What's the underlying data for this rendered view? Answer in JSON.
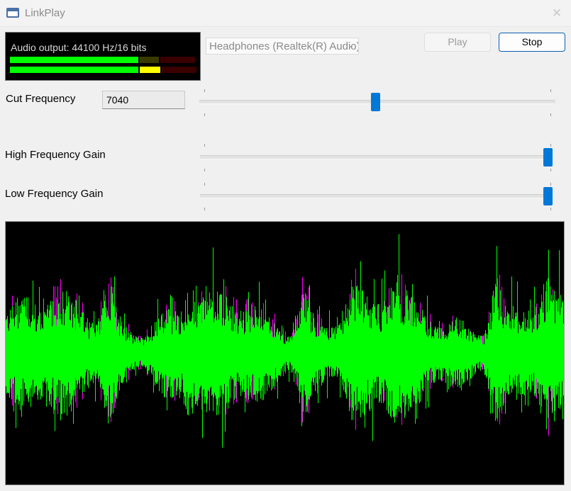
{
  "window": {
    "title": "LinkPlay",
    "close_glyph": "✕"
  },
  "vu_meter": {
    "label": "Audio output: 44100 Hz/16 bits",
    "channel_levels": [
      0.69,
      0.71
    ],
    "peak_fraction": 0.79,
    "colors": {
      "green": "#00ff00",
      "yellow": "#ffff00",
      "dim_olive": "#3a3a00",
      "dim_red": "#3a0000"
    }
  },
  "device_select": {
    "value": "Headphones (Realtek(R) Audio)"
  },
  "buttons": {
    "play_label": "Play",
    "stop_label": "Stop"
  },
  "cut_frequency": {
    "label": "Cut Frequency",
    "value": "7040",
    "slider_fraction": 0.495
  },
  "high_gain": {
    "label": "High Frequency Gain",
    "slider_fraction": 1.0
  },
  "low_gain": {
    "label": "Low Frequency Gain",
    "slider_fraction": 1.0
  },
  "waveform": {
    "colors": {
      "left": "#00ff00",
      "right": "#ff00ff",
      "background": "#000000"
    }
  }
}
